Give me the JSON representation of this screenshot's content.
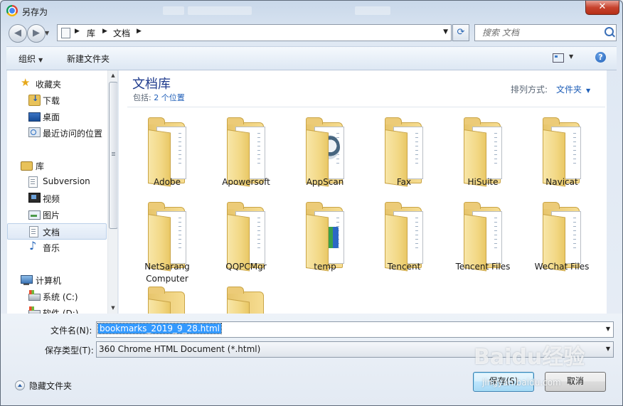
{
  "window": {
    "title": "另存为",
    "close_label": "✕"
  },
  "address": {
    "crumbs": [
      "库",
      "文档"
    ],
    "search_placeholder": "搜索 文档"
  },
  "toolbar": {
    "organize": "组织",
    "new_folder": "新建文件夹",
    "help": "?"
  },
  "nav": {
    "favorites": {
      "label": "收藏夹",
      "items": [
        "下载",
        "桌面",
        "最近访问的位置"
      ]
    },
    "libraries": {
      "label": "库",
      "items": [
        "Subversion",
        "视频",
        "图片",
        "文档",
        "音乐"
      ],
      "selected": "文档"
    },
    "computer": {
      "label": "计算机",
      "items": [
        "系统 (C:)",
        "软件 (D:)"
      ]
    }
  },
  "library": {
    "title": "文档库",
    "includes_prefix": "包括:",
    "includes_link": "2 个位置",
    "arrange_label": "排列方式:",
    "arrange_value": "文件夹"
  },
  "folders": [
    "Adobe",
    "Apowersoft",
    "AppScan",
    "Fax",
    "HiSuite",
    "Navicat",
    "NetSarang Computer",
    "QQPCMgr",
    "temp",
    "Tencent",
    "Tencent Files",
    "WeChat Files"
  ],
  "form": {
    "filename_label": "文件名(N):",
    "filename_value": "bookmarks_2019_9_28.html",
    "filetype_label": "保存类型(T):",
    "filetype_value": "360 Chrome HTML Document (*.html)",
    "hide_folders": "隐藏文件夹",
    "save": "保存(S)",
    "cancel": "取消"
  },
  "watermark": {
    "logo": "Baidu经验",
    "url": "jingyan.baidu.com"
  }
}
